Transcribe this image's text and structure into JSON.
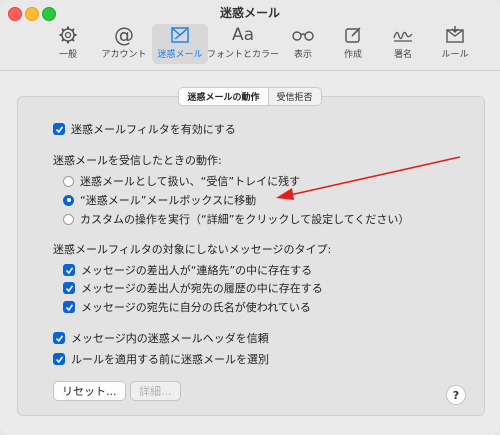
{
  "window": {
    "title": "迷惑メール"
  },
  "toolbar": {
    "items": [
      {
        "label": "一般",
        "icon": "gear-icon"
      },
      {
        "label": "アカウント",
        "icon": "at-icon"
      },
      {
        "label": "迷惑メール",
        "icon": "junk-mail-icon"
      },
      {
        "label": "フォントとカラー",
        "icon": "font-icon",
        "glyph": "Aa"
      },
      {
        "label": "表示",
        "icon": "glasses-icon"
      },
      {
        "label": "作成",
        "icon": "compose-icon"
      },
      {
        "label": "署名",
        "icon": "signature-icon"
      },
      {
        "label": "ルール",
        "icon": "rules-icon"
      }
    ]
  },
  "tabs": {
    "active": "迷惑メールの動作",
    "other": "受信拒否"
  },
  "junk": {
    "enable_filter": "迷惑メールフィルタを有効にする",
    "when_received": "迷惑メールを受信したときの動作:",
    "radio1": "迷惑メールとして扱い、“受信”トレイに残す",
    "radio2": "“迷惑メール”メールボックスに移動",
    "radio3": "カスタムの操作を実行（“詳細”をクリックして設定してください）",
    "exempt_heading": "迷惑メールフィルタの対象にしないメッセージのタイプ:",
    "exempt1": "メッセージの差出人が“連絡先”の中に存在する",
    "exempt2": "メッセージの差出人が宛先の履歴の中に存在する",
    "exempt3": "メッセージの宛先に自分の氏名が使われている",
    "trust_headers": "メッセージ内の迷惑メールヘッダを信頼",
    "filter_before_rules": "ルールを適用する前に迷惑メールを選別"
  },
  "buttons": {
    "reset": "リセット...",
    "advanced": "詳細...",
    "help": "?"
  },
  "colors": {
    "accent": "#0a63d8",
    "annotation_arrow": "#e0201b"
  }
}
